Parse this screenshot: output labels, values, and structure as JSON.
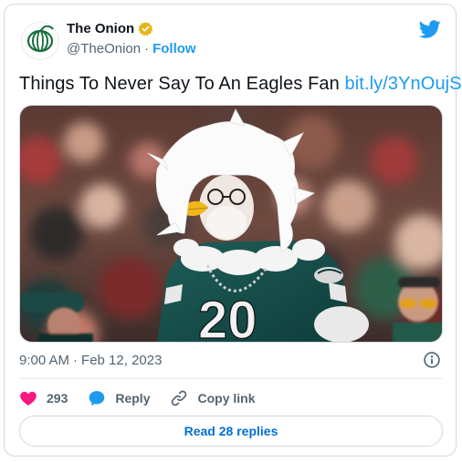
{
  "account": {
    "display_name": "The Onion",
    "handle": "@TheOnion",
    "separator": "·",
    "follow_label": "Follow"
  },
  "tweet": {
    "text": "Things To Never Say To An Eagles Fan",
    "link_text": "bit.ly/3YnOujS"
  },
  "meta": {
    "time": "9:00 AM",
    "separator": "·",
    "date": "Feb 12, 2023"
  },
  "actions": {
    "like_count": "293",
    "reply_label": "Reply",
    "copy_link_label": "Copy link"
  },
  "read_replies_label": "Read 28 replies",
  "icons": {
    "avatar": "onion-logo-icon",
    "verified": "verified-badge-icon",
    "brand": "twitter-bird-icon",
    "info": "info-icon",
    "like": "heart-icon",
    "reply": "speech-bubble-icon",
    "copy": "link-icon"
  },
  "colors": {
    "accent": "#1d9bf0",
    "like": "#f91880",
    "verified": "#e2b719",
    "avatar_green": "#1a6e3f",
    "replies_text": "#006fd6"
  }
}
